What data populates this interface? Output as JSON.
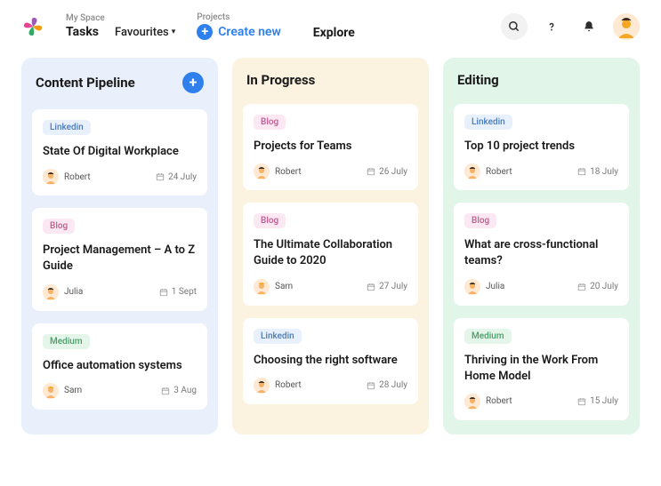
{
  "header": {
    "mySpace": {
      "eyebrow": "My Space",
      "tasks": "Tasks",
      "favourites": "Favourites"
    },
    "projects": {
      "eyebrow": "Projects",
      "create": "Create new"
    },
    "explore": "Explore"
  },
  "columns": [
    {
      "id": "pipeline",
      "title": "Content Pipeline",
      "color": "blue",
      "showAdd": true,
      "cards": [
        {
          "tag": "Linkedin",
          "tagColor": "blue",
          "title": "State Of Digital Workplace",
          "assignee": "Robert",
          "avatar": "robert",
          "date": "24 July"
        },
        {
          "tag": "Blog",
          "tagColor": "pink",
          "title": "Project Management – A to Z Guide",
          "assignee": "Julia",
          "avatar": "julia",
          "date": "1 Sept"
        },
        {
          "tag": "Medium",
          "tagColor": "green",
          "title": "Office automation systems",
          "assignee": "Sam",
          "avatar": "sam",
          "date": "3 Aug"
        }
      ]
    },
    {
      "id": "progress",
      "title": "In Progress",
      "color": "orange",
      "showAdd": false,
      "cards": [
        {
          "tag": "Blog",
          "tagColor": "pink",
          "title": "Projects for Teams",
          "assignee": "Robert",
          "avatar": "robert",
          "date": "26 July"
        },
        {
          "tag": "Blog",
          "tagColor": "pink",
          "title": "The Ultimate Collaboration Guide to 2020",
          "assignee": "Sam",
          "avatar": "sam",
          "date": "27 July"
        },
        {
          "tag": "Linkedin",
          "tagColor": "blue",
          "title": "Choosing the right software",
          "assignee": "Robert",
          "avatar": "robert",
          "date": "28 July"
        }
      ]
    },
    {
      "id": "editing",
      "title": "Editing",
      "color": "green",
      "showAdd": false,
      "cards": [
        {
          "tag": "Linkedin",
          "tagColor": "blue",
          "title": "Top 10 project trends",
          "assignee": "Robert",
          "avatar": "robert",
          "date": "18 July"
        },
        {
          "tag": "Blog",
          "tagColor": "pink",
          "title": "What are cross-functional teams?",
          "assignee": "Julia",
          "avatar": "julia",
          "date": "20 July"
        },
        {
          "tag": "Medium",
          "tagColor": "green",
          "title": "Thriving in the Work From Home Model",
          "assignee": "Robert",
          "avatar": "robert",
          "date": "15 July"
        }
      ]
    }
  ]
}
